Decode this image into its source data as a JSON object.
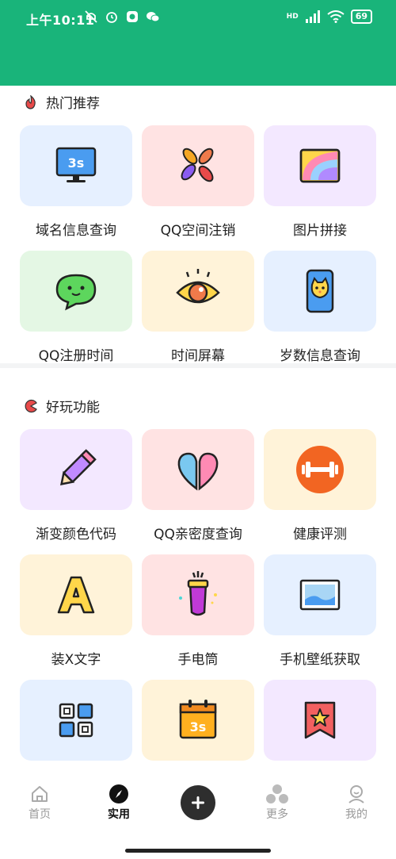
{
  "status_bar": {
    "time": "上午10:11",
    "network": "HD",
    "battery": "69"
  },
  "colors": {
    "brand": "#19b47a",
    "tile_blue": "#e6f0ff",
    "tile_pink": "#ffe3e3",
    "tile_purple": "#f3e8ff",
    "tile_green": "#e4f7e4",
    "tile_yellow": "#fff3d9"
  },
  "sections": [
    {
      "title": "热门推荐",
      "icon": "flame-icon",
      "items": [
        {
          "label": "域名信息查询",
          "icon": "monitor-3s-icon"
        },
        {
          "label": "QQ空间注销",
          "icon": "pinwheel-icon"
        },
        {
          "label": "图片拼接",
          "icon": "rainbow-picture-icon"
        },
        {
          "label": "QQ注册时间",
          "icon": "chat-bubble-face-icon"
        },
        {
          "label": "时间屏幕",
          "icon": "eye-icon"
        },
        {
          "label": "岁数信息查询",
          "icon": "phone-cat-icon"
        }
      ]
    },
    {
      "title": "好玩功能",
      "icon": "pacman-icon",
      "items": [
        {
          "label": "渐变颜色代码",
          "icon": "pencil-icon"
        },
        {
          "label": "QQ亲密度查询",
          "icon": "split-heart-icon"
        },
        {
          "label": "健康评测",
          "icon": "dumbbell-icon"
        },
        {
          "label": "装X文字",
          "icon": "letter-a-icon"
        },
        {
          "label": "手电筒",
          "icon": "flashlight-icon"
        },
        {
          "label": "手机壁纸获取",
          "icon": "wallpaper-icon"
        },
        {
          "label": "",
          "icon": "grid-squares-icon"
        },
        {
          "label": "",
          "icon": "calendar-3s-icon"
        },
        {
          "label": "",
          "icon": "star-ribbon-icon"
        }
      ]
    }
  ],
  "nav": {
    "home": "首页",
    "practical": "实用",
    "more": "更多",
    "mine": "我的"
  }
}
